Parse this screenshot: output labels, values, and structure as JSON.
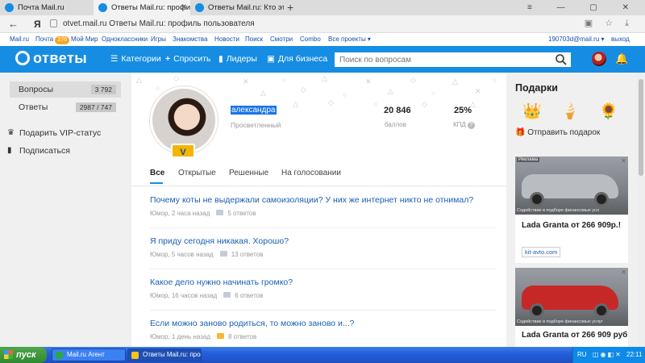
{
  "browser": {
    "tabs": [
      {
        "label": "Почта Mail.ru",
        "color": "#168de2"
      },
      {
        "label": "Ответы Mail.ru: профил",
        "color": "#168de2",
        "active": true
      },
      {
        "label": "Ответы Mail.ru: Кто это тут",
        "color": "#168de2"
      }
    ],
    "new_tab": "+",
    "url_domain": "otvet.mail.ru",
    "url_title": "Ответы Mail.ru: профиль пользователя",
    "yandex": "Я"
  },
  "mailbar": {
    "items": [
      "Mail.ru",
      "Почта",
      "Мой Мир",
      "Одноклассники",
      "Игры",
      "Знакомства",
      "Новости",
      "Поиск",
      "Смотри",
      "Combo",
      "Все проекты ▾"
    ],
    "mail_badge": "276",
    "email": "190703d@mail.ru ▾",
    "logout": "выход"
  },
  "header": {
    "logo": "ответы",
    "nav": [
      "Категории",
      "Спросить",
      "Лидеры",
      "Для бизнеса"
    ],
    "search_placeholder": "Поиск по вопросам"
  },
  "sidebar": {
    "items": [
      {
        "label": "Вопросы",
        "count": "3 792"
      },
      {
        "label": "Ответы",
        "count": "2987 / 747"
      }
    ],
    "links": [
      "Подарить VIP-статус",
      "Подписаться"
    ]
  },
  "profile": {
    "username": "александра",
    "rank": "Просветленный",
    "points": "20 846",
    "points_label": "баллов",
    "kpd": "25%",
    "kpd_label": "КПД",
    "vip_badge": "V",
    "tabs": [
      "Все",
      "Открытые",
      "Решенные",
      "На голосовании"
    ]
  },
  "questions": [
    {
      "title": "Почему коты не выдержали самоизоляции? У них же интернет никто не отнимал?",
      "meta": "Юмор, 2 часа назад",
      "answers": "5 ответов",
      "highlight": false
    },
    {
      "title": "Я приду сегодня никакая. Хорошо?",
      "meta": "Юмор, 5 часов назад",
      "answers": "13 ответов",
      "highlight": false
    },
    {
      "title": "Какое дело нужно начинать громко?",
      "meta": "Юмор, 16 часов назад",
      "answers": "6 ответов",
      "highlight": false
    },
    {
      "title": "Если можно заново родиться, то можно заново и...?",
      "meta": "Юмор, 1 день назад",
      "answers": "8 ответов",
      "highlight": true
    }
  ],
  "right": {
    "gifts_title": "Подарки",
    "gifts": [
      "👑",
      "🍦",
      "🌻"
    ],
    "send_gift": "Отправить подарок",
    "ads": [
      {
        "label": "Реклама",
        "title": "Lada Granta от 266 909р.!",
        "link": "kit-avto.com",
        "fine": "Содействие в подборе финансовых усл",
        "car_color": "#b9bcc0"
      },
      {
        "label": "",
        "title": "Lada Granta от 266 909 руб",
        "link": "",
        "fine": "Содействие в подборе финансовых услуг",
        "car_color": "#c62828"
      }
    ]
  },
  "taskbar": {
    "start": "пуск",
    "tasks": [
      "Mail.ru Агент",
      "Ответы Mail.ru: проф..."
    ],
    "lang": "RU",
    "time": "22:11"
  }
}
